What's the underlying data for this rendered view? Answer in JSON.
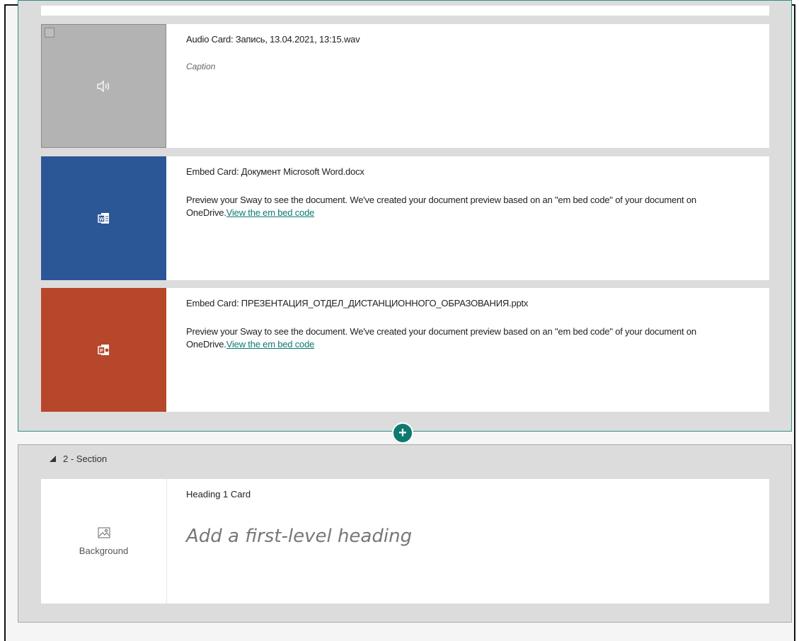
{
  "section1": {
    "cards": [
      {
        "type": "audio",
        "title": "Audio Card: Запись, 13.04.2021, 13:15.wav",
        "caption": "Caption",
        "icon": "speaker-icon"
      },
      {
        "type": "embed-word",
        "title": "Embed Card: Документ Microsoft Word.docx",
        "description": "Preview your Sway to see the document. We've created your document preview based on an \"em bed code\" of your document on OneDrive.",
        "link": "View the em bed code",
        "icon": "word-icon",
        "color": "#2b5797"
      },
      {
        "type": "embed-ppt",
        "title": "Embed Card: ПРЕЗЕНТАЦИЯ_ОТДЕЛ_ДИСТАНЦИОННОГО_ОБРАЗОВАНИЯ.pptx",
        "description": "Preview your Sway to see the document. We've created your document preview based on an \"em bed code\" of your document on OneDrive.",
        "link": "View the em bed code",
        "icon": "powerpoint-icon",
        "color": "#b7472a"
      }
    ]
  },
  "add_button": "+",
  "section2": {
    "label": "2 - Section",
    "heading_card": {
      "title": "Heading 1 Card",
      "placeholder": "Add a first-level heading",
      "background_label": "Background",
      "background_icon": "image-icon"
    }
  },
  "colors": {
    "accent": "#0d7a6d",
    "link": "#0e7a6e",
    "section_border": "#2f8f86"
  }
}
